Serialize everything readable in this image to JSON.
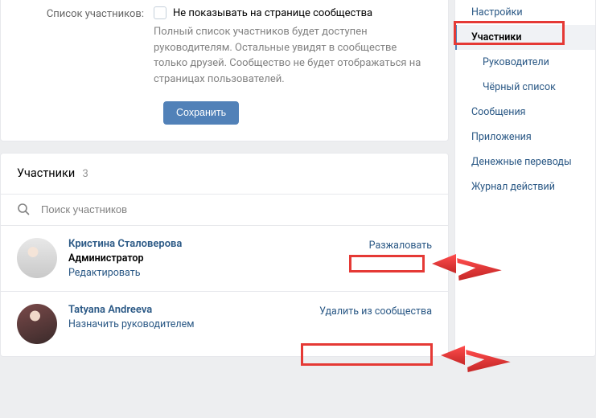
{
  "settings": {
    "row_label": "Список участников:",
    "checkbox_label": "Не показывать на странице сообщества",
    "desc": "Полный список участников будет доступен руководителям. Остальные увидят в сообществе только друзей. Сообщество не будет отображаться на страницах пользователей.",
    "save": "Сохранить"
  },
  "members_panel": {
    "title": "Участники",
    "count": "3",
    "search_placeholder": "Поиск участников"
  },
  "members": [
    {
      "name": "Кристина Сталоверова",
      "role": "Администратор",
      "link": "Редактировать",
      "right": "Разжаловать"
    },
    {
      "name": "Tatyana Andreeva",
      "role": "",
      "link": "Назначить руководителем",
      "right": "Удалить из сообщества"
    }
  ],
  "sidebar": {
    "items": [
      {
        "label": "Настройки",
        "sub": false,
        "active": false
      },
      {
        "label": "Участники",
        "sub": false,
        "active": true
      },
      {
        "label": "Руководители",
        "sub": true,
        "active": false
      },
      {
        "label": "Чёрный список",
        "sub": true,
        "active": false
      },
      {
        "label": "Сообщения",
        "sub": false,
        "active": false
      },
      {
        "label": "Приложения",
        "sub": false,
        "active": false
      },
      {
        "label": "Денежные переводы",
        "sub": false,
        "active": false
      },
      {
        "label": "Журнал действий",
        "sub": false,
        "active": false
      }
    ]
  }
}
